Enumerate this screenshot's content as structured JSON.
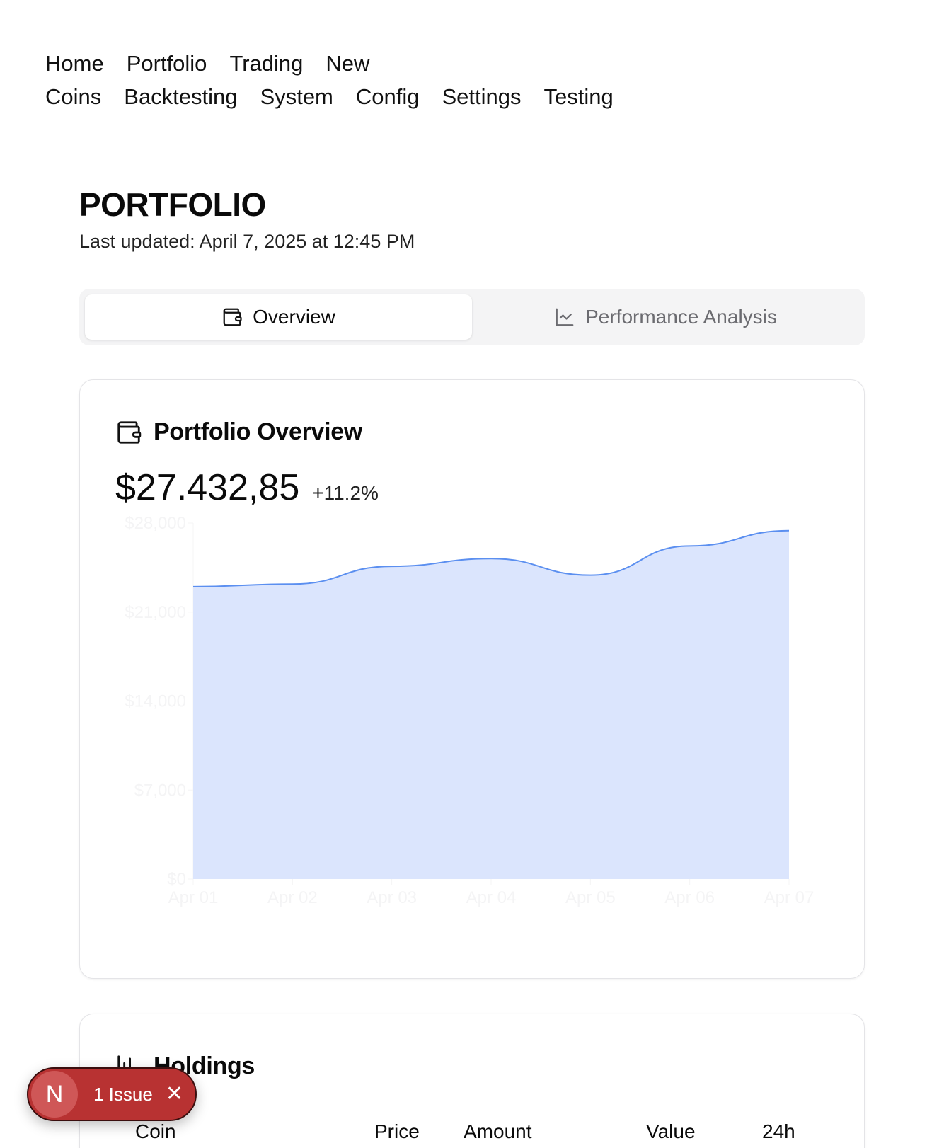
{
  "nav": {
    "row1": [
      "Home",
      "Portfolio",
      "Trading",
      "New"
    ],
    "row2": [
      "Coins",
      "Backtesting",
      "System",
      "Config",
      "Settings",
      "Testing"
    ]
  },
  "header": {
    "title": "PORTFOLIO",
    "last_updated": "Last updated: April 7, 2025 at 12:45 PM"
  },
  "tabs": [
    {
      "label": "Overview",
      "icon": "wallet-icon",
      "active": true
    },
    {
      "label": "Performance Analysis",
      "icon": "line-chart-icon",
      "active": false
    }
  ],
  "overview": {
    "title": "Portfolio Overview",
    "value": "$27.432,85",
    "change": "+11.2%"
  },
  "holdings": {
    "title": "Holdings",
    "columns": [
      "Coin",
      "Price",
      "Amount",
      "Value",
      "24h"
    ]
  },
  "issue_badge": {
    "logo": "N",
    "label": "1 Issue"
  },
  "colors": {
    "accent": "#5b8ff0",
    "area_fill": "#dbe5fd",
    "issue_bg": "#b83232"
  },
  "chart_data": {
    "type": "area",
    "x": [
      "Apr 01",
      "Apr 02",
      "Apr 03",
      "Apr 04",
      "Apr 05",
      "Apr 06",
      "Apr 07"
    ],
    "values": [
      23000,
      23200,
      24600,
      25200,
      23900,
      26200,
      27400
    ],
    "yticks": [
      "$0",
      "$7,000",
      "$14,000",
      "$21,000",
      "$28,000"
    ],
    "ylim": [
      0,
      28000
    ],
    "grid": false,
    "legend": "none"
  }
}
